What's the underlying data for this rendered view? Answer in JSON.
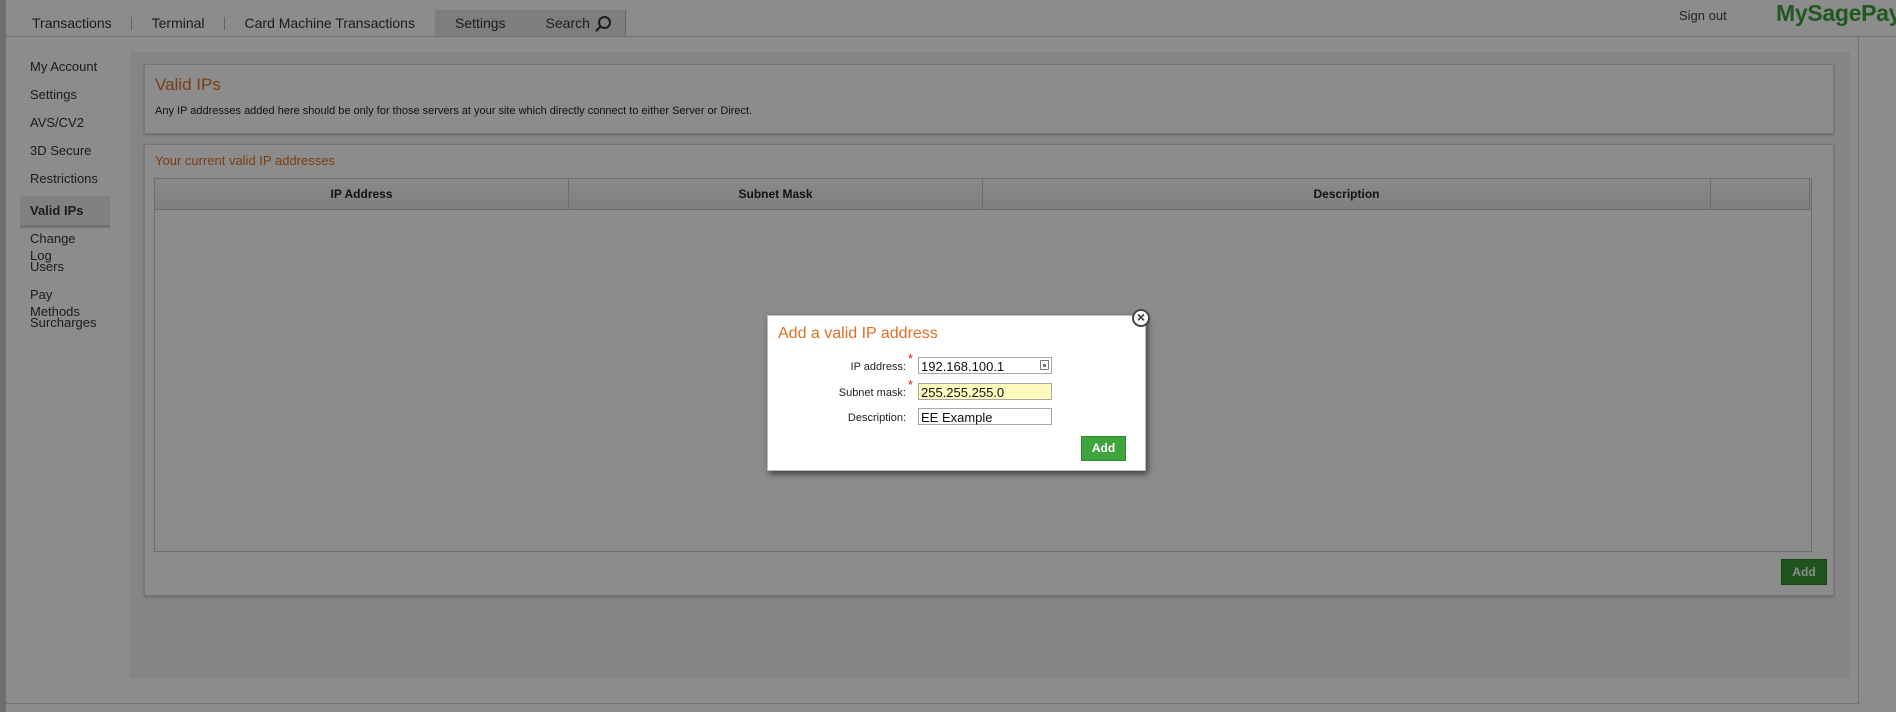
{
  "nav": {
    "items": [
      {
        "label": "Transactions"
      },
      {
        "label": "Terminal"
      },
      {
        "label": "Card Machine Transactions"
      },
      {
        "label": "Settings",
        "active": true
      },
      {
        "label": "Search",
        "icon": "search-icon"
      }
    ],
    "signout": "Sign out",
    "logo": "MySagePay"
  },
  "sidebar": {
    "items": [
      {
        "label": "My Account"
      },
      {
        "label": "Settings"
      },
      {
        "label": "AVS/CV2"
      },
      {
        "label": "3D Secure"
      },
      {
        "label": "Restrictions"
      },
      {
        "label": "Valid IPs",
        "active": true
      },
      {
        "label": "Change Log"
      },
      {
        "label": "Users"
      },
      {
        "label": "Pay Methods"
      },
      {
        "label": "Surcharges"
      }
    ]
  },
  "main": {
    "title": "Valid IPs",
    "description": "Any IP addresses added here should be only for those servers at your site which directly connect to either Server or Direct.",
    "current_title": "Your current valid IP addresses",
    "table": {
      "columns": [
        "IP Address",
        "Subnet Mask",
        "Description",
        ""
      ]
    },
    "add_label": "Add"
  },
  "modal": {
    "title": "Add a valid IP address",
    "fields": {
      "ip_label": "IP address:",
      "ip_value": "192.168.100.1",
      "subnet_label": "Subnet mask:",
      "subnet_value": "255.255.255.0",
      "description_label": "Description:",
      "description_value": "EE Example"
    },
    "required_mark": "*",
    "close_label": "×",
    "add_label": "Add"
  },
  "colors": {
    "accent_orange": "#e07024",
    "brand_green": "#3aa339",
    "highlight_yellow": "#fffbbd"
  }
}
